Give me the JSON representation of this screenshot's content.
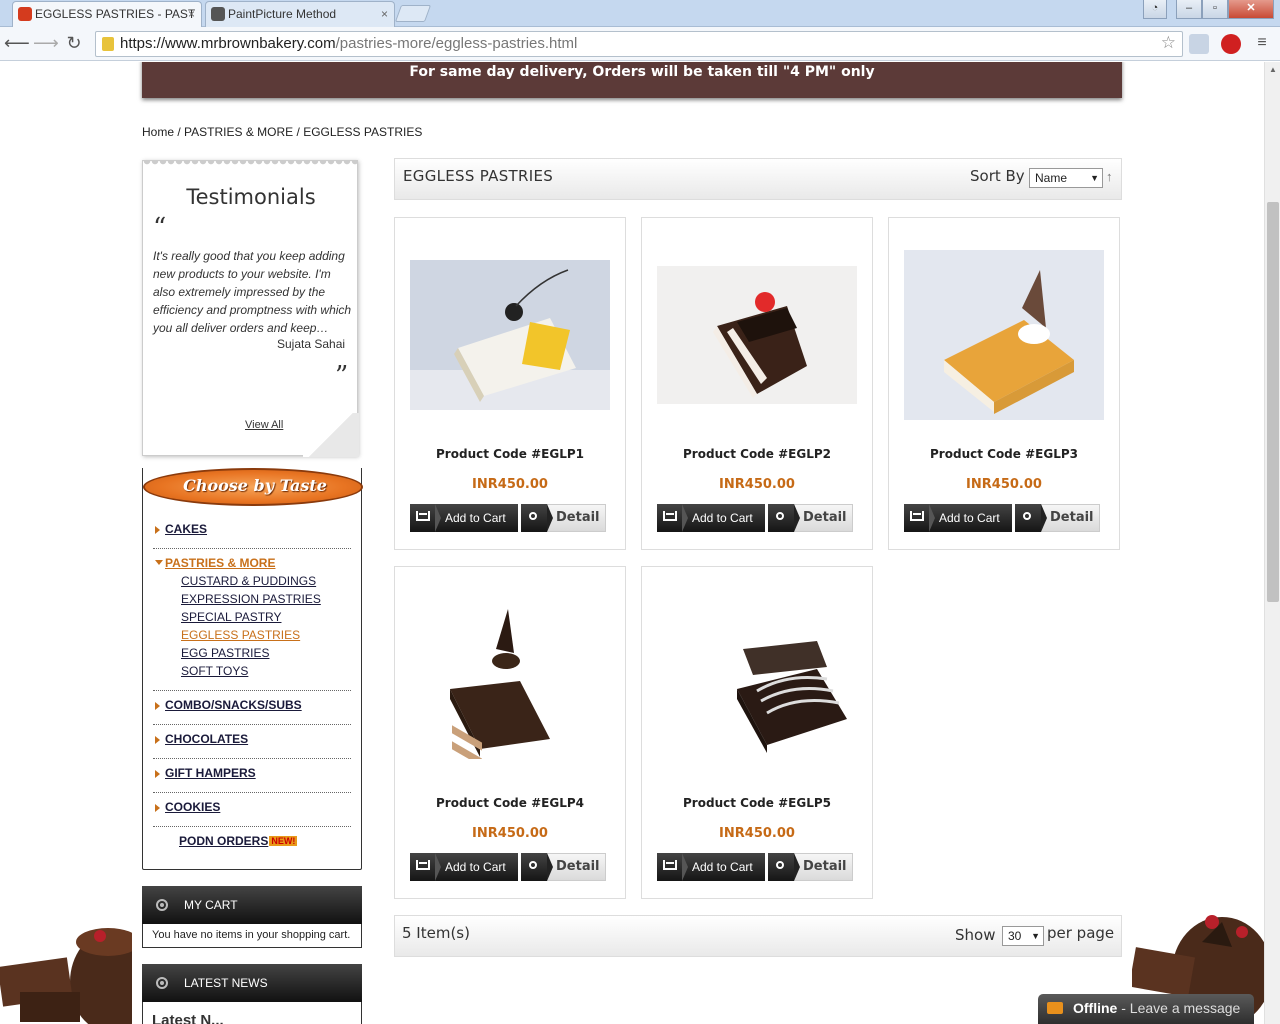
{
  "browser": {
    "tabs": [
      {
        "title": "EGGLESS PASTRIES - PAST",
        "close": "×"
      },
      {
        "title": "PaintPicture Method",
        "close": "×"
      }
    ],
    "url_host": "https://www.mrbrownbakery.com",
    "url_path": "/pastries-more/eggless-pastries.html"
  },
  "banner": {
    "text": "For same day delivery, Orders will be taken till \"4 PM\" only"
  },
  "breadcrumb": {
    "home": "Home",
    "sep1": " / ",
    "category": "PASTRIES & MORE",
    "sep2": " / ",
    "current": "EGGLESS PASTRIES"
  },
  "testimonials": {
    "title": "Testimonials",
    "open_quote": "“",
    "quote": "It's really good that you keep adding new products to your website. I'm also extremely impressed by the efficiency and promptness with which you all deliver orders and keep…",
    "author": "Sujata Sahai",
    "close_quote": "”",
    "view_all": "View All"
  },
  "choose_by_taste": {
    "title": "Choose by Taste",
    "categories": [
      "CAKES",
      "PASTRIES & MORE",
      "COMBO/SNACKS/SUBS",
      "CHOCOLATES",
      "GIFT HAMPERS",
      "COOKIES"
    ],
    "subcategories": [
      "CUSTARD & PUDDINGS",
      "EXPRESSION PASTRIES",
      "SPECIAL PASTRY",
      "EGGLESS PASTRIES",
      "EGG PASTRIES",
      "SOFT TOYS"
    ],
    "podn": "PODN ORDERS",
    "new_badge": "NEW!"
  },
  "my_cart": {
    "title": "MY CART",
    "empty": "You have no items in your shopping cart."
  },
  "latest_news": {
    "title": "LATEST NEWS",
    "preview": "Latest N..."
  },
  "listing": {
    "title": "EGGLESS PASTRIES",
    "sort_label": "Sort By",
    "sort_value": "Name",
    "sort_dir": "↑",
    "item_count": "5 Item(s)",
    "show_label": "Show",
    "per_page_value": "30",
    "per_page_label": "per page",
    "add_to_cart": "Add to Cart",
    "detail": "Detail"
  },
  "products": [
    {
      "code": "Product Code #EGLP1",
      "price": "INR450.00"
    },
    {
      "code": "Product Code #EGLP2",
      "price": "INR450.00"
    },
    {
      "code": "Product Code #EGLP3",
      "price": "INR450.00"
    },
    {
      "code": "Product Code #EGLP4",
      "price": "INR450.00"
    },
    {
      "code": "Product Code #EGLP5",
      "price": "INR450.00"
    }
  ],
  "chat": {
    "status": "Offline",
    "message": " - Leave a message"
  },
  "colors": {
    "banner": "#5c3a38",
    "accent": "#c8701a",
    "price": "#c66a16",
    "dark_button": "#1a1a1a"
  }
}
